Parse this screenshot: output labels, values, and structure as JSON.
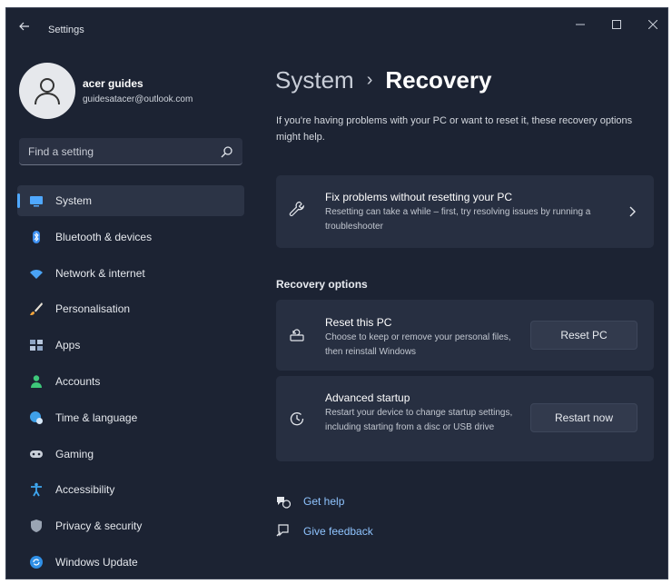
{
  "app": {
    "title": "Settings"
  },
  "profile": {
    "name": "acer guides",
    "email": "guidesatacer@outlook.com"
  },
  "search": {
    "placeholder": "Find a setting"
  },
  "sidebar": {
    "accent_color": "#4fa8ff",
    "items": [
      {
        "label": "System",
        "icon": "monitor-icon",
        "active": true
      },
      {
        "label": "Bluetooth & devices",
        "icon": "bluetooth-icon"
      },
      {
        "label": "Network & internet",
        "icon": "wifi-icon"
      },
      {
        "label": "Personalisation",
        "icon": "brush-icon"
      },
      {
        "label": "Apps",
        "icon": "apps-icon"
      },
      {
        "label": "Accounts",
        "icon": "person-icon"
      },
      {
        "label": "Time & language",
        "icon": "globe-clock-icon"
      },
      {
        "label": "Gaming",
        "icon": "gamepad-icon"
      },
      {
        "label": "Accessibility",
        "icon": "accessibility-icon"
      },
      {
        "label": "Privacy & security",
        "icon": "shield-icon"
      },
      {
        "label": "Windows Update",
        "icon": "update-icon"
      }
    ]
  },
  "main": {
    "breadcrumb": {
      "parent": "System",
      "separator": "›",
      "current": "Recovery"
    },
    "intro": "If you're having problems with your PC or want to reset it, these recovery options might help.",
    "fix_card": {
      "title": "Fix problems without resetting your PC",
      "description": "Resetting can take a while – first, try resolving issues by running a troubleshooter"
    },
    "section_title": "Recovery options",
    "reset_card": {
      "title": "Reset this PC",
      "description": "Choose to keep or remove your personal files, then reinstall Windows",
      "button": "Reset PC"
    },
    "advanced_card": {
      "title": "Advanced startup",
      "description": "Restart your device to change startup settings, including starting from a disc or USB drive",
      "button": "Restart now"
    },
    "links": [
      {
        "label": "Get help",
        "icon": "help-icon"
      },
      {
        "label": "Give feedback",
        "icon": "feedback-icon"
      }
    ]
  }
}
